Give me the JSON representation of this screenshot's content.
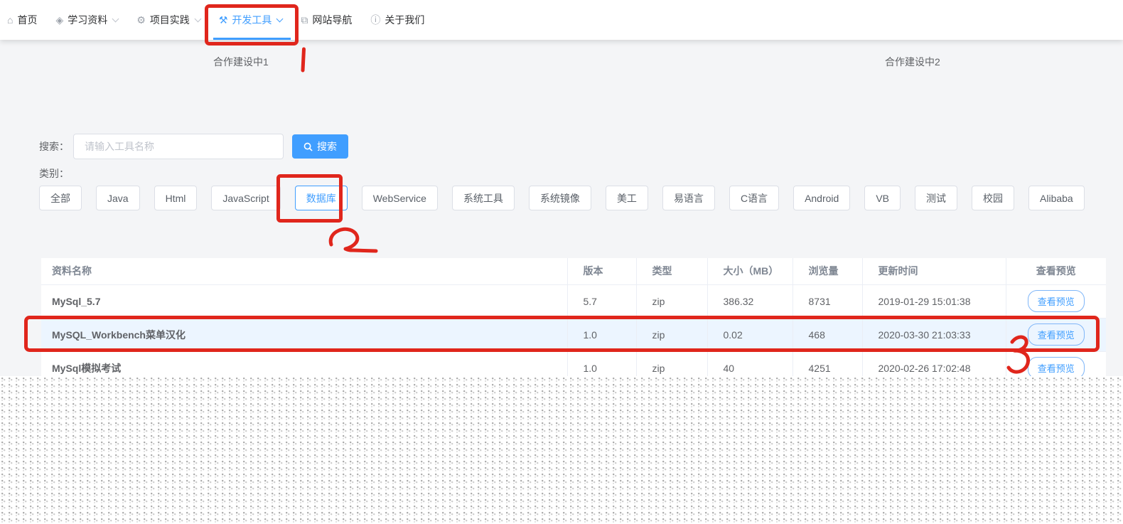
{
  "icons": {
    "home-icon": "⌂",
    "study-icon": "◈",
    "project-icon": "⚙",
    "tools-icon": "⚒",
    "sitenav-icon": "⧉",
    "about-icon": "ⓘ"
  },
  "nav": {
    "items": [
      {
        "label": "首页",
        "icon": "home-icon",
        "dropdown": false,
        "active": false
      },
      {
        "label": "学习资料",
        "icon": "study-icon",
        "dropdown": true,
        "active": false
      },
      {
        "label": "项目实践",
        "icon": "project-icon",
        "dropdown": true,
        "active": false
      },
      {
        "label": "开发工具",
        "icon": "tools-icon",
        "dropdown": true,
        "active": true
      },
      {
        "label": "网站导航",
        "icon": "sitenav-icon",
        "dropdown": false,
        "active": false
      },
      {
        "label": "关于我们",
        "icon": "about-icon",
        "dropdown": false,
        "active": false
      }
    ]
  },
  "banners": {
    "left": "合作建设中1",
    "right": "合作建设中2"
  },
  "search": {
    "label": "搜索：",
    "placeholder": "请输入工具名称",
    "button_label": "搜索"
  },
  "category": {
    "label": "类别：",
    "active_item": "数据库",
    "items": [
      "全部",
      "Java",
      "Html",
      "JavaScript",
      "数据库",
      "WebService",
      "系统工具",
      "系统镜像",
      "美工",
      "易语言",
      "C语言",
      "Android",
      "VB",
      "测试",
      "校园",
      "Alibaba"
    ]
  },
  "table": {
    "columns": [
      "资料名称",
      "版本",
      "类型",
      "大小（MB）",
      "浏览量",
      "更新时间",
      "查看预览"
    ],
    "rows": [
      {
        "name": "MySql_5.7",
        "version": "5.7",
        "type": "zip",
        "size": "386.32",
        "views": "8731",
        "updated": "2019-01-29 15:01:38",
        "action": "查看预览"
      },
      {
        "name": "MySQL_Workbench菜单汉化",
        "version": "1.0",
        "type": "zip",
        "size": "0.02",
        "views": "468",
        "updated": "2020-03-30 21:03:33",
        "action": "查看预览"
      },
      {
        "name": "MySql模拟考试",
        "version": "1.0",
        "type": "zip",
        "size": "40",
        "views": "4251",
        "updated": "2020-02-26 17:02:48",
        "action": "查看预览"
      }
    ]
  },
  "annotations": {
    "color": "#e0261c",
    "steps": [
      "1",
      "2",
      "3"
    ]
  },
  "colors": {
    "accent": "#409EFF",
    "page_bg": "#f4f5f7",
    "row_highlight": "#ecf5ff"
  }
}
